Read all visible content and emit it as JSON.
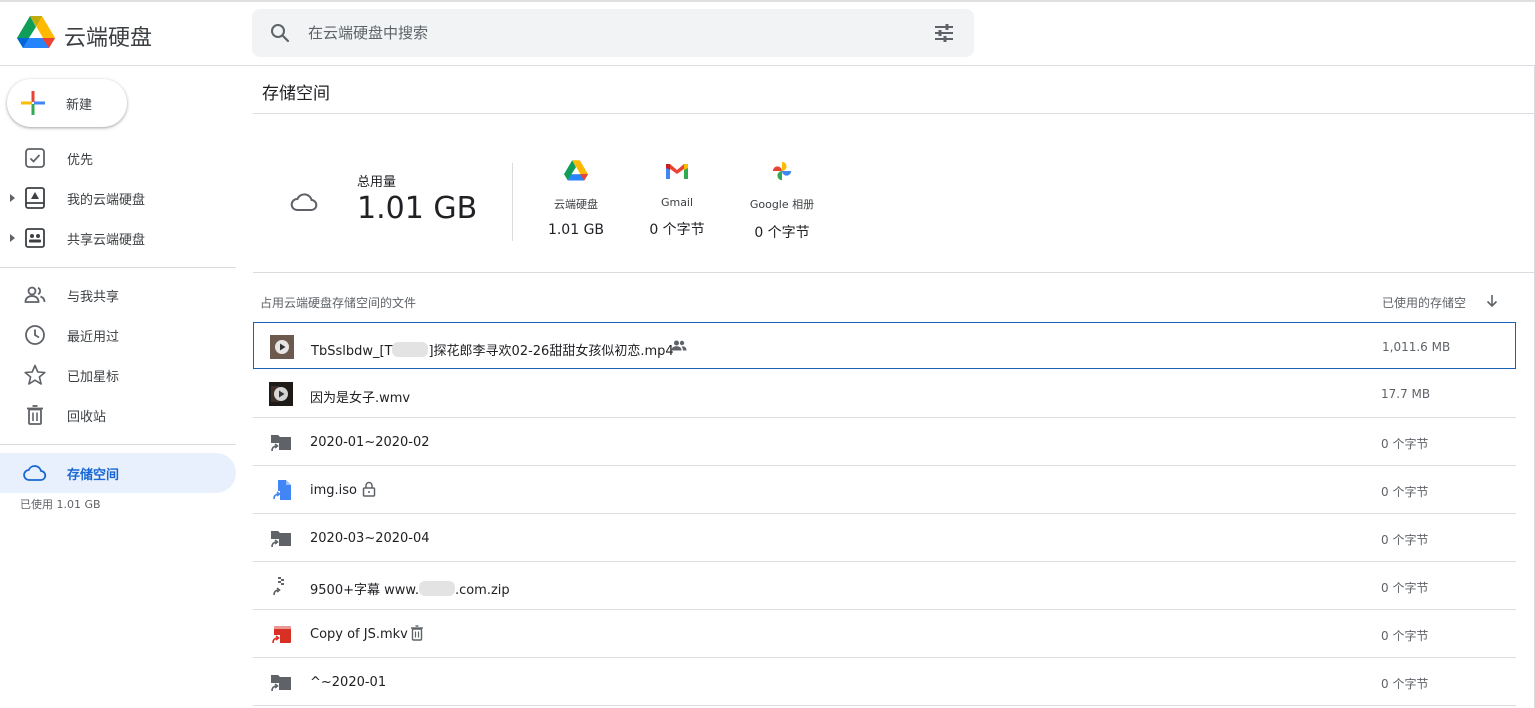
{
  "header": {
    "app_title": "云端硬盘",
    "search_placeholder": "在云端硬盘中搜索"
  },
  "sidebar": {
    "new_label": "新建",
    "items": [
      {
        "label": "优先",
        "icon": "priority-icon"
      },
      {
        "label": "我的云端硬盘",
        "icon": "my-drive-icon"
      },
      {
        "label": "共享云端硬盘",
        "icon": "shared-drives-icon"
      },
      {
        "label": "与我共享",
        "icon": "shared-with-me-icon"
      },
      {
        "label": "最近用过",
        "icon": "recent-icon"
      },
      {
        "label": "已加星标",
        "icon": "starred-icon"
      },
      {
        "label": "回收站",
        "icon": "trash-icon"
      },
      {
        "label": "存储空间",
        "icon": "cloud-icon"
      }
    ],
    "storage_used": "已使用 1.01 GB"
  },
  "main": {
    "title": "存储空间",
    "total_label": "总用量",
    "total_value": "1.01 GB",
    "services": [
      {
        "name": "云端硬盘",
        "value": "1.01 GB",
        "icon": "drive-icon"
      },
      {
        "name": "Gmail",
        "value": "0 个字节",
        "icon": "gmail-icon"
      },
      {
        "name": "Google 相册",
        "value": "0 个字节",
        "icon": "photos-icon"
      }
    ],
    "list_header_left": "占用云端硬盘存储空间的文件",
    "list_header_right": "已使用的存储空",
    "files": [
      {
        "name_a": "TbSslbdw_[T",
        "name_b": "]探花郎李寻欢02-26甜甜女孩似初恋.mp4",
        "size": "1,011.6 MB",
        "icon": "video-thumbnail-icon",
        "badge": "shared-people-icon"
      },
      {
        "name": "因为是女子.wmv",
        "size": "17.7 MB",
        "icon": "video-thumbnail-icon"
      },
      {
        "name": "2020-01~2020-02",
        "size": "0 个字节",
        "icon": "folder-shortcut-icon"
      },
      {
        "name": "img.iso",
        "size": "0 个字节",
        "icon": "file-shortcut-icon",
        "badge": "lock-icon"
      },
      {
        "name": "2020-03~2020-04",
        "size": "0 个字节",
        "icon": "folder-shortcut-icon"
      },
      {
        "name_a": "9500+字幕 www.",
        "name_b": ".com.zip",
        "size": "0 个字节",
        "icon": "zip-shortcut-icon"
      },
      {
        "name": "Copy of JS.mkv",
        "size": "0 个字节",
        "icon": "video-shortcut-icon",
        "badge": "trash-icon"
      },
      {
        "name": "^~2020-01",
        "size": "0 个字节",
        "icon": "folder-shortcut-icon"
      }
    ]
  },
  "colors": {
    "accent": "#1967d2",
    "active_bg": "#e8f0fe",
    "selected_border": "#1a5fb4",
    "divider": "#dadce0"
  }
}
